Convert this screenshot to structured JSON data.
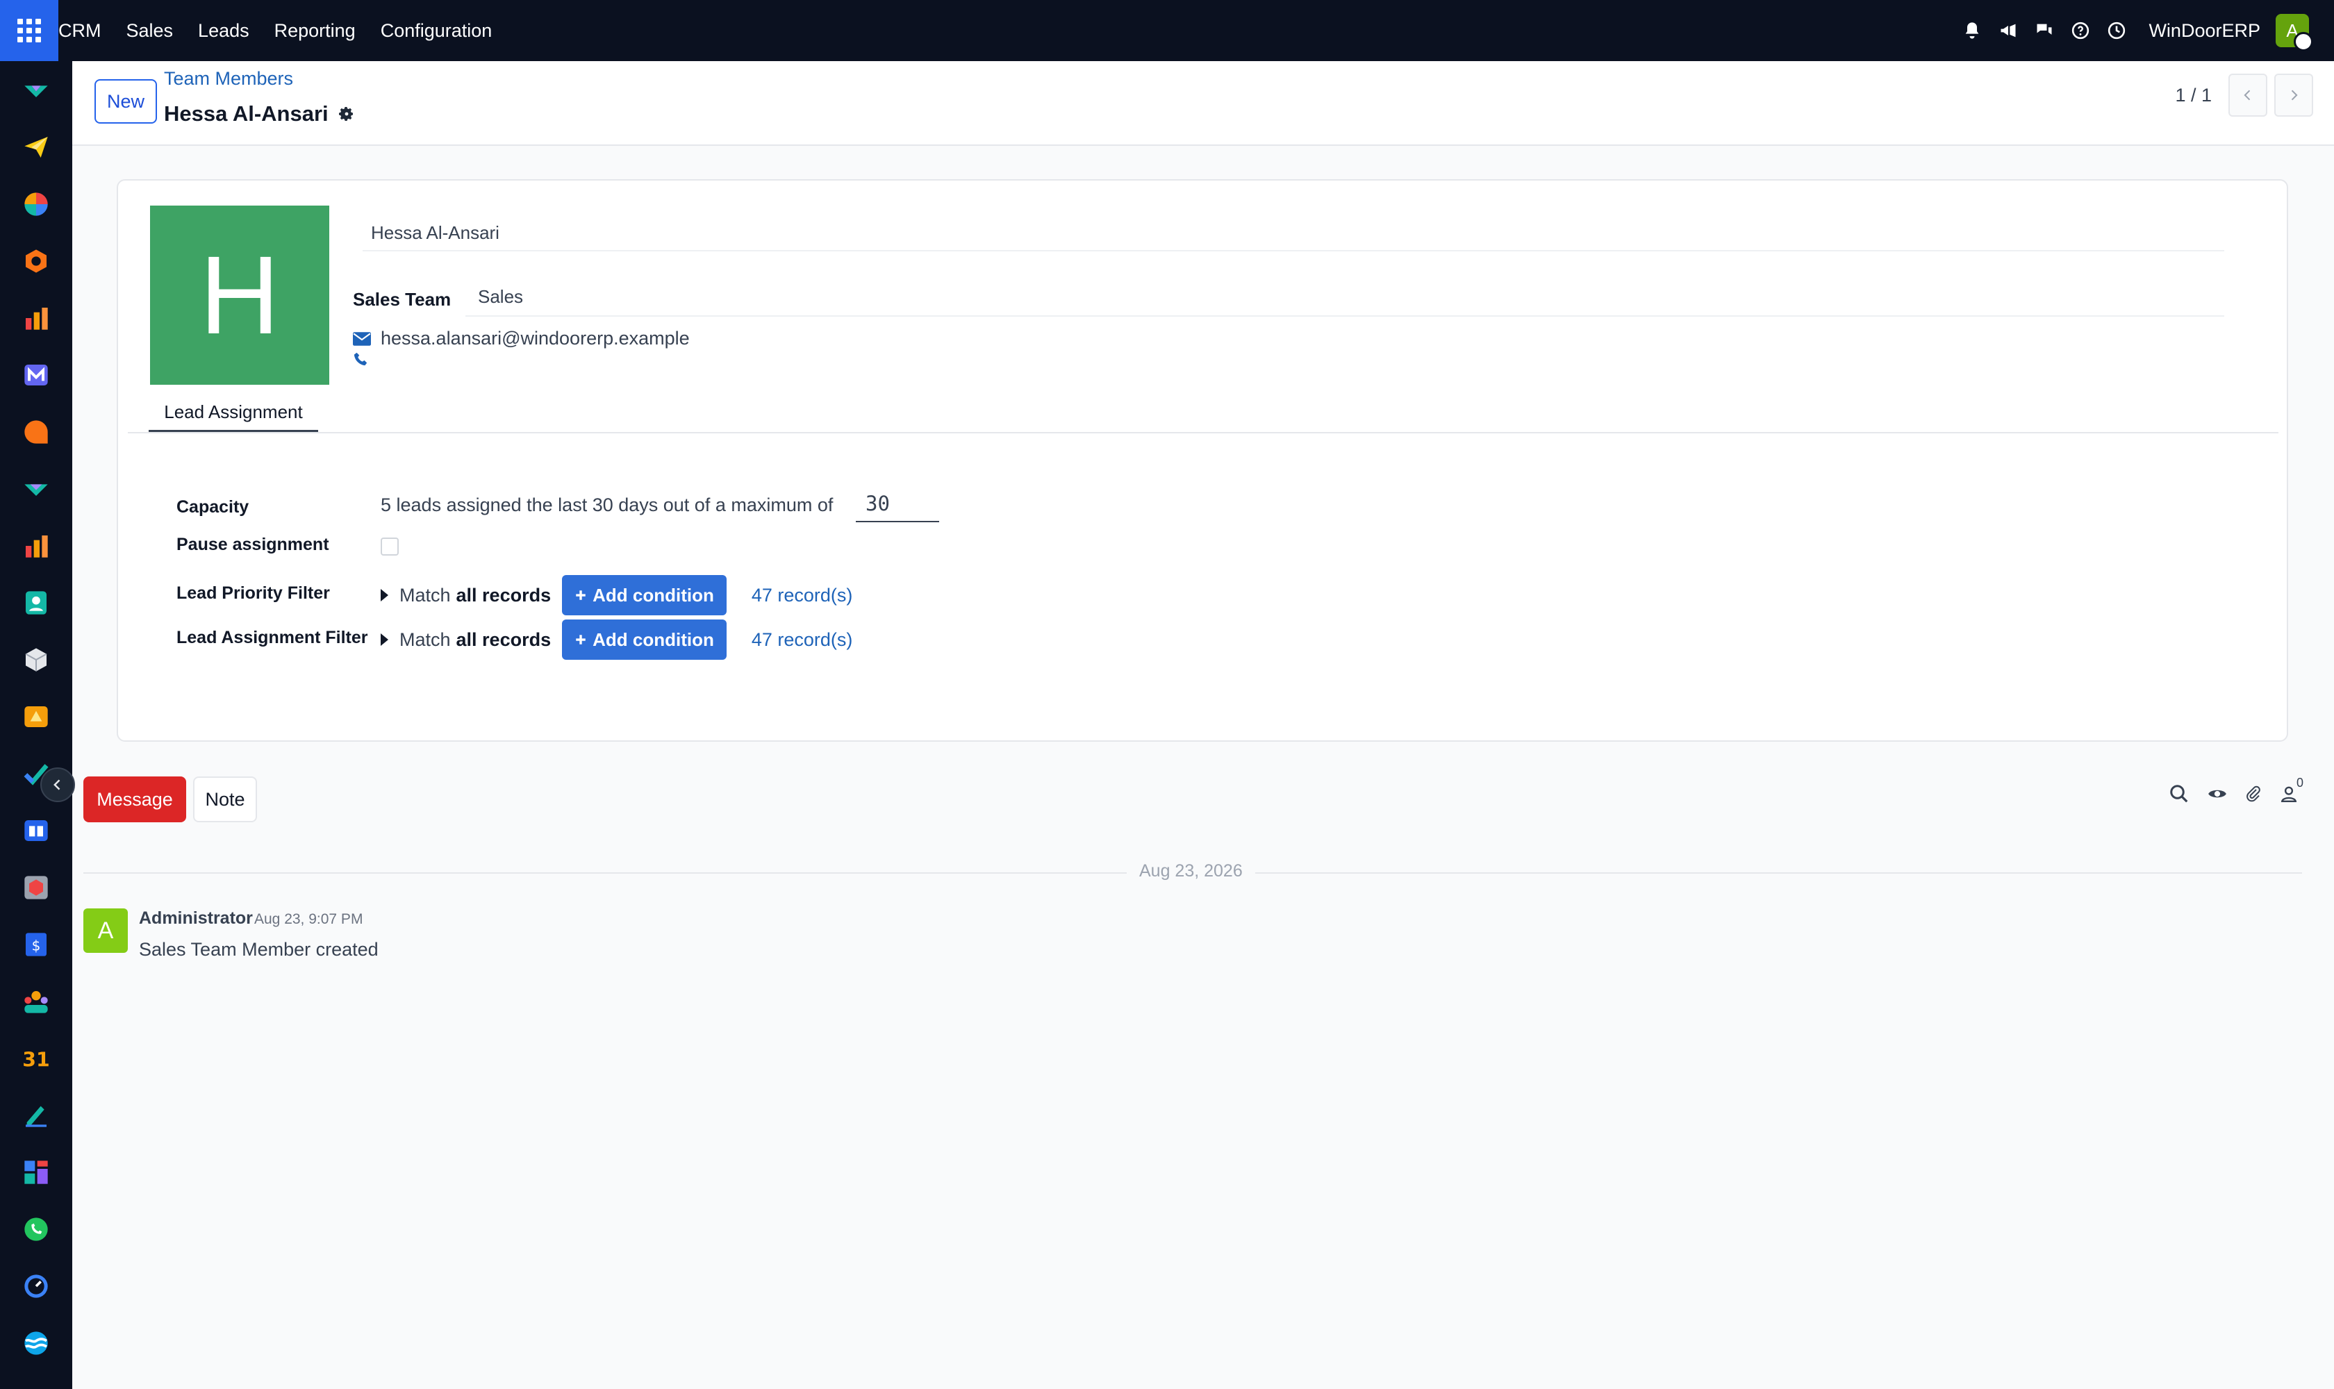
{
  "navbar": {
    "menu": [
      "CRM",
      "Sales",
      "Leads",
      "Reporting",
      "Configuration"
    ],
    "company": "WinDoorERP",
    "user_initial": "A"
  },
  "control_panel": {
    "new_label": "New",
    "breadcrumb_parent": "Team Members",
    "record_title": "Hessa Al-Ansari",
    "pager": "1 / 1"
  },
  "form": {
    "avatar_letter": "H",
    "name": "Hessa Al-Ansari",
    "sales_team_label": "Sales Team",
    "sales_team_value": "Sales",
    "email": "hessa.alansari@windoorerp.example",
    "tab_lead_assignment": "Lead Assignment",
    "capacity_label": "Capacity",
    "capacity_text": "5 leads assigned the last 30 days out of a maximum of",
    "capacity_max": "30",
    "pause_label": "Pause assignment",
    "pause_checked": false,
    "priority_filter_label": "Lead Priority Filter",
    "assignment_filter_label": "Lead Assignment Filter",
    "match_prefix": "Match",
    "match_value": "all records",
    "add_condition": "Add condition",
    "records_count": "47 record(s)"
  },
  "chatter": {
    "message_btn": "Message",
    "note_btn": "Note",
    "follower_count": "0",
    "date_separator": "Aug 23, 2026",
    "message": {
      "avatar_letter": "A",
      "author": "Administrator",
      "time": "Aug 23, 9:07 PM",
      "body": "Sales Team Member created"
    }
  },
  "colors": {
    "primary": "#2563eb",
    "avatar_bg": "#3ea364",
    "message_btn": "#dc2626",
    "link": "#1e63b8"
  }
}
